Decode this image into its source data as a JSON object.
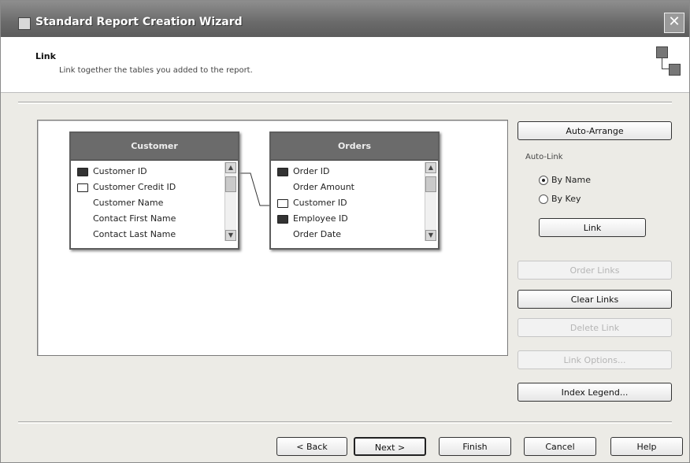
{
  "window": {
    "title": "Standard Report Creation Wizard",
    "close_glyph": "✕"
  },
  "header": {
    "title": "Link",
    "description": "Link together the tables you added to the report."
  },
  "tables": [
    {
      "name": "Customer",
      "fields": [
        {
          "label": "Customer ID",
          "key": "solid"
        },
        {
          "label": "Customer Credit ID",
          "key": "hollow"
        },
        {
          "label": "Customer Name",
          "key": "none"
        },
        {
          "label": "Contact First Name",
          "key": "none"
        },
        {
          "label": "Contact Last Name",
          "key": "none"
        }
      ]
    },
    {
      "name": "Orders",
      "fields": [
        {
          "label": "Order ID",
          "key": "solid"
        },
        {
          "label": "Order Amount",
          "key": "none"
        },
        {
          "label": "Customer ID",
          "key": "hollow"
        },
        {
          "label": "Employee ID",
          "key": "solid"
        },
        {
          "label": "Order Date",
          "key": "none"
        }
      ]
    }
  ],
  "side": {
    "auto_arrange": "Auto-Arrange",
    "auto_link_label": "Auto-Link",
    "by_name": "By Name",
    "by_key": "By Key",
    "link": "Link",
    "order_links": "Order Links",
    "clear_links": "Clear Links",
    "delete_link": "Delete Link",
    "link_options": "Link Options...",
    "index_legend": "Index Legend..."
  },
  "footer": {
    "back": "< Back",
    "next": "Next >",
    "finish": "Finish",
    "cancel": "Cancel",
    "help": "Help"
  },
  "icons": {
    "window_icon": "report-wizard-icon",
    "header_icon": "link-tables-icon"
  }
}
